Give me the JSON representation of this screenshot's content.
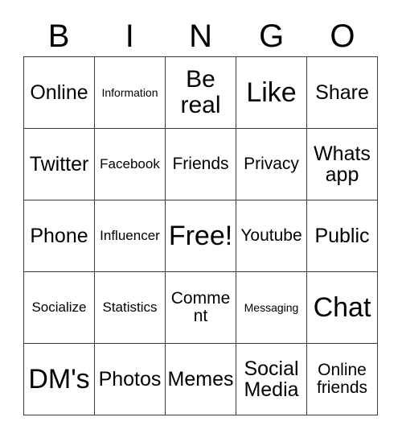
{
  "card": {
    "title": "BINGO",
    "header_letters": [
      "B",
      "I",
      "N",
      "G",
      "O"
    ],
    "colors": {
      "background": "#ffffff",
      "text": "#000000",
      "border": "#3a3a3a"
    },
    "grid": {
      "rows": 5,
      "columns": 5,
      "free_space": "Free!",
      "free_space_position": {
        "row": 3,
        "column": 3
      }
    },
    "cells": [
      {
        "row": 1,
        "col": 1,
        "text": "Online",
        "size": "lg"
      },
      {
        "row": 1,
        "col": 2,
        "text": "Information",
        "size": "xs"
      },
      {
        "row": 1,
        "col": 3,
        "text": "Be real",
        "size": "xl"
      },
      {
        "row": 1,
        "col": 4,
        "text": "Like",
        "size": "xxl"
      },
      {
        "row": 1,
        "col": 5,
        "text": "Share",
        "size": "lg"
      },
      {
        "row": 2,
        "col": 1,
        "text": "Twitter",
        "size": "lg"
      },
      {
        "row": 2,
        "col": 2,
        "text": "Facebook",
        "size": "sm"
      },
      {
        "row": 2,
        "col": 3,
        "text": "Friends",
        "size": "md"
      },
      {
        "row": 2,
        "col": 4,
        "text": "Privacy",
        "size": "md"
      },
      {
        "row": 2,
        "col": 5,
        "text": "Whats app",
        "size": "lg"
      },
      {
        "row": 3,
        "col": 1,
        "text": "Phone",
        "size": "lg"
      },
      {
        "row": 3,
        "col": 2,
        "text": "Influencer",
        "size": "sm"
      },
      {
        "row": 3,
        "col": 3,
        "text": "Free!",
        "size": "xxl"
      },
      {
        "row": 3,
        "col": 4,
        "text": "Youtube",
        "size": "md"
      },
      {
        "row": 3,
        "col": 5,
        "text": "Public",
        "size": "lg"
      },
      {
        "row": 4,
        "col": 1,
        "text": "Socialize",
        "size": "sm"
      },
      {
        "row": 4,
        "col": 2,
        "text": "Statistics",
        "size": "sm"
      },
      {
        "row": 4,
        "col": 3,
        "text": "Comment",
        "size": "md"
      },
      {
        "row": 4,
        "col": 4,
        "text": "Messaging",
        "size": "xs"
      },
      {
        "row": 4,
        "col": 5,
        "text": "Chat",
        "size": "xxl"
      },
      {
        "row": 5,
        "col": 1,
        "text": "DM's",
        "size": "xxl"
      },
      {
        "row": 5,
        "col": 2,
        "text": "Photos",
        "size": "lg"
      },
      {
        "row": 5,
        "col": 3,
        "text": "Memes",
        "size": "lg"
      },
      {
        "row": 5,
        "col": 4,
        "text": "Social Media",
        "size": "lg"
      },
      {
        "row": 5,
        "col": 5,
        "text": "Online friends",
        "size": "md"
      }
    ]
  }
}
